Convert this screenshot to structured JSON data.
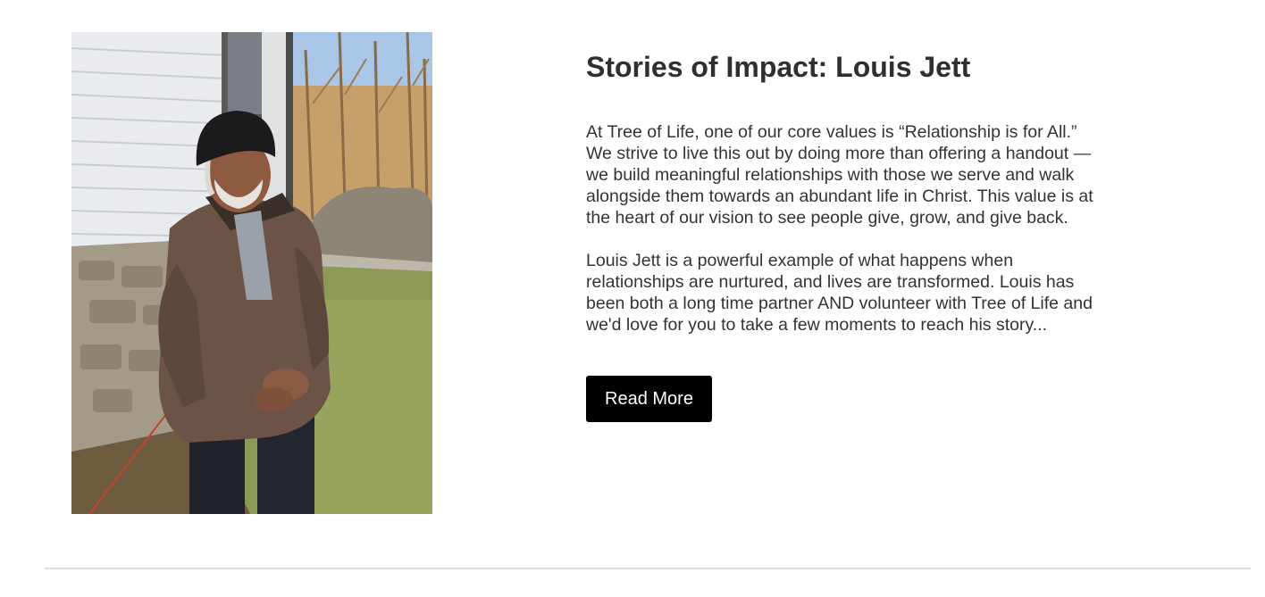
{
  "story": {
    "title": "Stories of Impact: Louis Jett",
    "paragraphs": [
      "At Tree of Life, one of our core values is “Relationship is for All.” We strive to live this out by doing more than offering a handout — we build meaningful relationships with those we serve and walk alongside them towards an abundant life in Christ. This value is at the heart of our vision to see people give, grow, and give back.",
      "Louis Jett is a powerful example of what happens when relationships are nurtured, and lives are transformed. Louis has been both a long time partner AND volunteer with Tree of Life and we'd love for you to take a few moments to reach his story..."
    ],
    "button_label": "Read More",
    "photo_description": "photo-of-louis-jett"
  },
  "colors": {
    "button_bg": "#000000",
    "button_text": "#ffffff",
    "title": "#2f2f2f",
    "body_text": "#333333",
    "divider": "#dedede"
  }
}
